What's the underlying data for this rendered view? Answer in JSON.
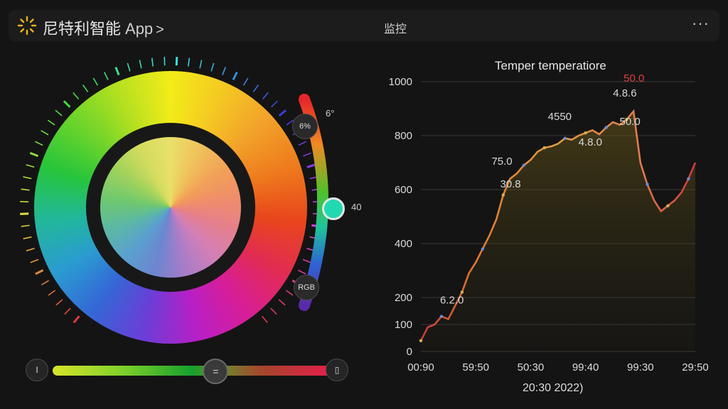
{
  "header": {
    "app_name": "尼特利智能",
    "app_suffix": "App",
    "chevron": ">",
    "center_title": "监控",
    "more_label": "···"
  },
  "wheel": {
    "side_label_top": "6°",
    "side_label_mid": "40",
    "knob_top_label": "6%",
    "knob_bottom_label": "RGB",
    "vertical_level": 0.55
  },
  "hslider": {
    "left_icon_label": "I",
    "thumb_label": "=",
    "right_icon_label": "▯",
    "value": 0.58
  },
  "chart_data": {
    "type": "line",
    "title": "Temper temperatiore",
    "ylim": [
      0,
      1000
    ],
    "yticks": [
      "0",
      "100",
      "200",
      "400",
      "600",
      "800",
      "1000"
    ],
    "ytick_values": [
      0,
      100,
      200,
      400,
      600,
      800,
      1000
    ],
    "xticks": [
      "00:90",
      "59:50",
      "50:30",
      "99:40",
      "99:30",
      "29:50"
    ],
    "xlabel": "20:30 2022)",
    "series": [
      {
        "values": [
          40,
          90,
          100,
          130,
          120,
          170,
          220,
          290,
          330,
          380,
          430,
          490,
          580,
          640,
          660,
          690,
          710,
          740,
          755,
          760,
          770,
          790,
          785,
          800,
          810,
          820,
          805,
          830,
          850,
          840,
          860,
          890,
          700,
          620,
          560,
          520,
          540,
          560,
          590,
          640,
          700
        ]
      }
    ],
    "annotations": [
      {
        "text": "6.2.0",
        "color": "#d9d9d9"
      },
      {
        "text": "30.8",
        "color": "#d9d9d9"
      },
      {
        "text": "75.0",
        "color": "#d9d9d9"
      },
      {
        "text": "4550",
        "color": "#d9d9d9"
      },
      {
        "text": "4.8.0",
        "color": "#d9d9d9"
      },
      {
        "text": "4.8.6",
        "color": "#d9d9d9"
      },
      {
        "text": "50.0",
        "color": "#d9d9d9"
      },
      {
        "text": "50.0",
        "color": "#e04040"
      }
    ]
  }
}
